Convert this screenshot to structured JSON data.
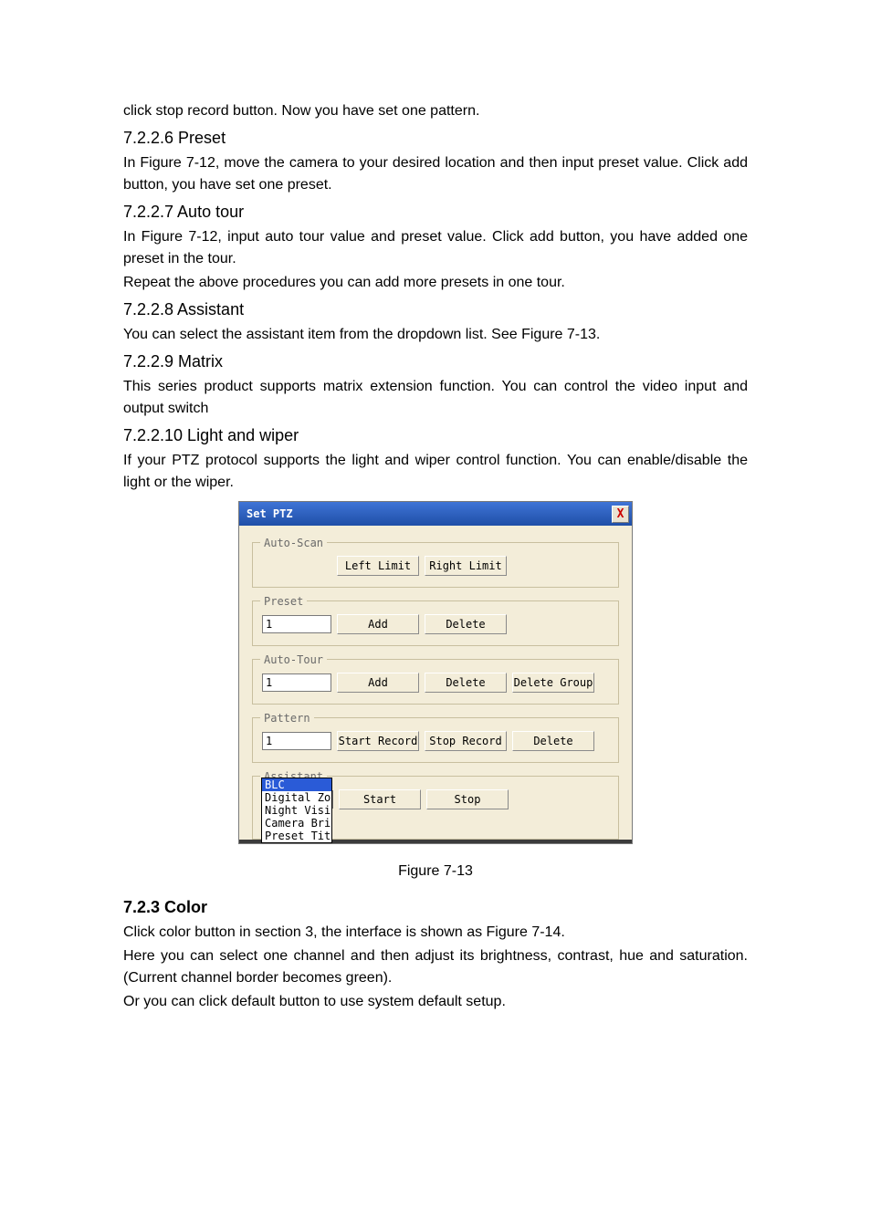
{
  "doc": {
    "line_intro": "click stop record button. Now you have set one pattern.",
    "s7226_heading": "7.2.2.6  Preset",
    "s7226_p1": "In Figure 7-12, move the camera to your desired location and then input preset value. Click add button, you have set one preset.",
    "s7227_heading": "7.2.2.7  Auto tour",
    "s7227_p1": "In Figure 7-12, input auto tour value and preset value. Click add button, you have added one preset in the tour.",
    "s7227_p2": "Repeat the above procedures you can add more presets in one tour.",
    "s7228_heading": "7.2.2.8  Assistant",
    "s7228_p1": "You can select the assistant item from the dropdown list. See Figure 7-13.",
    "s7229_heading": "7.2.2.9  Matrix",
    "s7229_p1": "This series product supports matrix extension function. You can control the video input and output switch",
    "s72210_heading": "7.2.2.10   Light and wiper",
    "s72210_p1": "If your PTZ protocol supports the light and wiper control function. You can enable/disable the light or the wiper.",
    "figure_caption": "Figure 7-13",
    "s723_heading": "7.2.3  Color",
    "s723_p1": "Click color button in section 3, the interface is shown as Figure 7-14.",
    "s723_p2": "Here you can select one channel and then adjust its brightness, contrast, hue and saturation. (Current channel border becomes green).",
    "s723_p3": "Or you can click default button to use system default setup."
  },
  "dlg": {
    "title": "Set PTZ",
    "close": "X",
    "autoscan": {
      "legend": "Auto-Scan",
      "left_limit": "Left Limit",
      "right_limit": "Right Limit"
    },
    "preset": {
      "legend": "Preset",
      "value": "1",
      "add": "Add",
      "delete": "Delete"
    },
    "autotour": {
      "legend": "Auto-Tour",
      "value": "1",
      "add": "Add",
      "delete": "Delete",
      "delete_group": "Delete Group"
    },
    "pattern": {
      "legend": "Pattern",
      "value": "1",
      "start_record": "Start Record",
      "stop_record": "Stop Record",
      "delete": "Delete"
    },
    "assistant": {
      "legend": "Assistant",
      "selected": "BLC",
      "start": "Start",
      "stop": "Stop",
      "options": {
        "o0": "BLC",
        "o1": "Digital Zoom",
        "o2": "Night Vision",
        "o3": "Camera Brightness",
        "o4": "Preset Title"
      }
    }
  }
}
